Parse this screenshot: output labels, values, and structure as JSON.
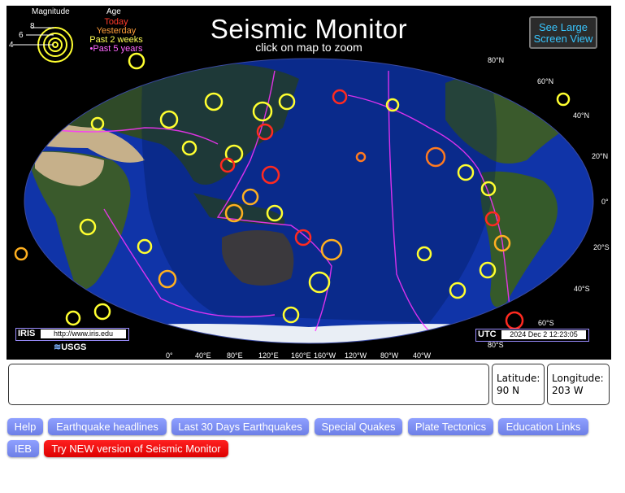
{
  "header": {
    "title": "Seismic Monitor",
    "subtitle": "click on map to zoom",
    "large_view_line1": "See Large",
    "large_view_line2": "Screen View"
  },
  "legend": {
    "magnitude_label": "Magnitude",
    "age_label": "Age",
    "magnitudes": [
      "8",
      "6",
      "4"
    ],
    "ages": [
      "Today",
      "Yesterday",
      "Past 2 weeks",
      "•Past 5 years"
    ]
  },
  "map": {
    "iris_label": "IRIS",
    "iris_url": "http://www.iris.edu",
    "usgs_label": "USGS",
    "utc_label": "UTC",
    "utc_time": "2024 Dec  2 12:23:05",
    "lat_labels": [
      "80°N",
      "60°N",
      "40°N",
      "20°N",
      "0°",
      "20°S",
      "40°S",
      "60°S",
      "80°S"
    ],
    "lon_labels": [
      "0°",
      "40°E",
      "80°E",
      "120°E",
      "160°E",
      "160°W",
      "120°W",
      "80°W",
      "40°W"
    ],
    "colors": {
      "ocean": "#0f2a9a",
      "land": "#2f4a28",
      "desert": "#c6b08a",
      "night_overlay": "#001a55",
      "today": "#ff2a20",
      "recent": "#ffb020",
      "past_2_weeks": "#ffff30",
      "past_5_years": "#ff33ff"
    }
  },
  "location": {
    "latitude_label": "Latitude:",
    "latitude_value": "90 N",
    "longitude_label": "Longitude:",
    "longitude_value": "203 W"
  },
  "buttons": {
    "help": "Help",
    "headlines": "Earthquake headlines",
    "last30": "Last 30 Days Earthquakes",
    "special": "Special Quakes",
    "plates": "Plate Tectonics",
    "education": "Education Links",
    "ieb": "IEB",
    "new_version": "Try NEW version of Seismic Monitor"
  }
}
